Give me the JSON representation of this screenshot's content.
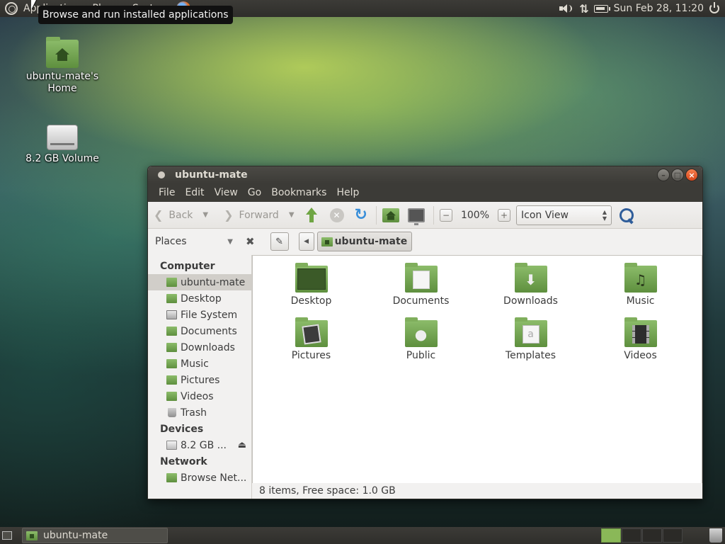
{
  "top_panel": {
    "menus": [
      "Applications",
      "Places",
      "System"
    ],
    "clock": "Sun Feb 28, 11:20"
  },
  "tooltip": "Browse and run installed applications",
  "desktop_icons": [
    {
      "label": "ubuntu-mate's Home",
      "icon": "home-folder-icon"
    },
    {
      "label": "8.2 GB Volume",
      "icon": "drive-icon"
    }
  ],
  "window": {
    "title": "ubuntu-mate",
    "menu": [
      "File",
      "Edit",
      "View",
      "Go",
      "Bookmarks",
      "Help"
    ],
    "toolbar": {
      "back_label": "Back",
      "forward_label": "Forward",
      "zoom": "100%",
      "view_mode": "Icon View"
    },
    "location": {
      "sidebar_mode": "Places",
      "path": "ubuntu-mate"
    },
    "sidebar": {
      "computer_header": "Computer",
      "computer_items": [
        "ubuntu-mate",
        "Desktop",
        "File System",
        "Documents",
        "Downloads",
        "Music",
        "Pictures",
        "Videos",
        "Trash"
      ],
      "devices_header": "Devices",
      "devices_items": [
        "8.2 GB ..."
      ],
      "network_header": "Network",
      "network_items": [
        "Browse Net..."
      ]
    },
    "files": [
      "Desktop",
      "Documents",
      "Downloads",
      "Music",
      "Pictures",
      "Public",
      "Templates",
      "Videos"
    ],
    "status": "8 items, Free space: 1.0 GB"
  },
  "bottom_panel": {
    "task_label": "ubuntu-mate"
  },
  "colors": {
    "panel": "#3c3b37",
    "folder_green": "#7fae5c",
    "close_orange": "#e05a24"
  }
}
